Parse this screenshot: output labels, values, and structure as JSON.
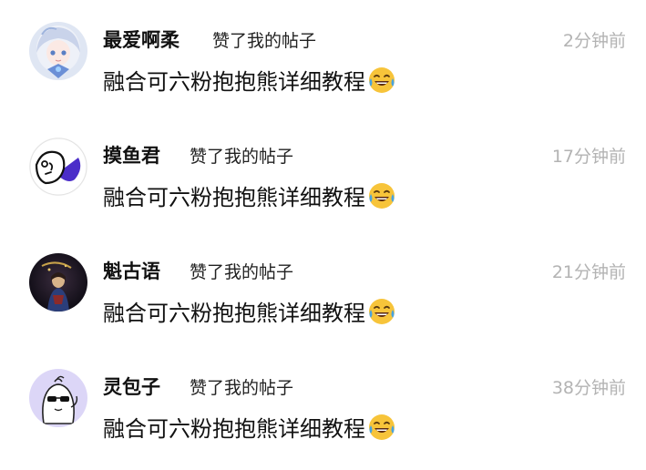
{
  "notifications": [
    {
      "user_name": "最爱啊柔",
      "action": "赞了我的帖子",
      "time": "2分钟前",
      "content": "融合可六粉抱抱熊详细教程",
      "avatar_icon": "anime-girl-avatar-icon",
      "emoji_icon": "tears-of-joy-emoji-icon"
    },
    {
      "user_name": "摸鱼君",
      "action": "赞了我的帖子",
      "time": "17分钟前",
      "content": "融合可六粉抱抱熊详细教程",
      "avatar_icon": "fish-avatar-icon",
      "emoji_icon": "tears-of-joy-emoji-icon"
    },
    {
      "user_name": "魁古语",
      "action": "赞了我的帖子",
      "time": "21分钟前",
      "content": "融合可六粉抱抱熊详细教程",
      "avatar_icon": "dark-figure-avatar-icon",
      "emoji_icon": "tears-of-joy-emoji-icon"
    },
    {
      "user_name": "灵包子",
      "action": "赞了我的帖子",
      "time": "38分钟前",
      "content": "融合可六粉抱抱熊详细教程",
      "avatar_icon": "bun-sunglasses-avatar-icon",
      "emoji_icon": "tears-of-joy-emoji-icon"
    }
  ],
  "colors": {
    "text_primary": "#111111",
    "text_secondary": "#222222",
    "timestamp": "#b3b3b3",
    "background": "#ffffff",
    "emoji_face": "#f7c43a",
    "emoji_tears": "#4aa3df"
  }
}
